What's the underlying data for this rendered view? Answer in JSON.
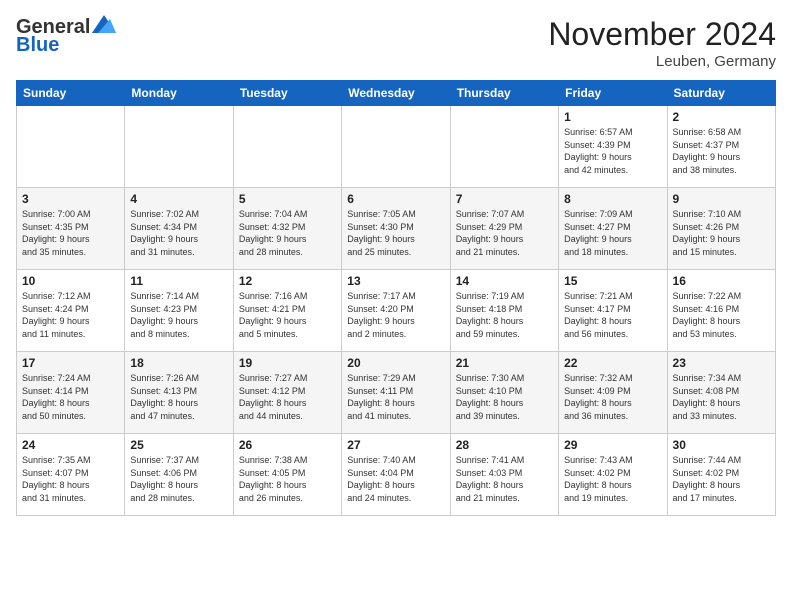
{
  "header": {
    "logo_general": "General",
    "logo_blue": "Blue",
    "month_title": "November 2024",
    "location": "Leuben, Germany"
  },
  "days_of_week": [
    "Sunday",
    "Monday",
    "Tuesday",
    "Wednesday",
    "Thursday",
    "Friday",
    "Saturday"
  ],
  "weeks": [
    [
      {
        "day": "",
        "info": ""
      },
      {
        "day": "",
        "info": ""
      },
      {
        "day": "",
        "info": ""
      },
      {
        "day": "",
        "info": ""
      },
      {
        "day": "",
        "info": ""
      },
      {
        "day": "1",
        "info": "Sunrise: 6:57 AM\nSunset: 4:39 PM\nDaylight: 9 hours\nand 42 minutes."
      },
      {
        "day": "2",
        "info": "Sunrise: 6:58 AM\nSunset: 4:37 PM\nDaylight: 9 hours\nand 38 minutes."
      }
    ],
    [
      {
        "day": "3",
        "info": "Sunrise: 7:00 AM\nSunset: 4:35 PM\nDaylight: 9 hours\nand 35 minutes."
      },
      {
        "day": "4",
        "info": "Sunrise: 7:02 AM\nSunset: 4:34 PM\nDaylight: 9 hours\nand 31 minutes."
      },
      {
        "day": "5",
        "info": "Sunrise: 7:04 AM\nSunset: 4:32 PM\nDaylight: 9 hours\nand 28 minutes."
      },
      {
        "day": "6",
        "info": "Sunrise: 7:05 AM\nSunset: 4:30 PM\nDaylight: 9 hours\nand 25 minutes."
      },
      {
        "day": "7",
        "info": "Sunrise: 7:07 AM\nSunset: 4:29 PM\nDaylight: 9 hours\nand 21 minutes."
      },
      {
        "day": "8",
        "info": "Sunrise: 7:09 AM\nSunset: 4:27 PM\nDaylight: 9 hours\nand 18 minutes."
      },
      {
        "day": "9",
        "info": "Sunrise: 7:10 AM\nSunset: 4:26 PM\nDaylight: 9 hours\nand 15 minutes."
      }
    ],
    [
      {
        "day": "10",
        "info": "Sunrise: 7:12 AM\nSunset: 4:24 PM\nDaylight: 9 hours\nand 11 minutes."
      },
      {
        "day": "11",
        "info": "Sunrise: 7:14 AM\nSunset: 4:23 PM\nDaylight: 9 hours\nand 8 minutes."
      },
      {
        "day": "12",
        "info": "Sunrise: 7:16 AM\nSunset: 4:21 PM\nDaylight: 9 hours\nand 5 minutes."
      },
      {
        "day": "13",
        "info": "Sunrise: 7:17 AM\nSunset: 4:20 PM\nDaylight: 9 hours\nand 2 minutes."
      },
      {
        "day": "14",
        "info": "Sunrise: 7:19 AM\nSunset: 4:18 PM\nDaylight: 8 hours\nand 59 minutes."
      },
      {
        "day": "15",
        "info": "Sunrise: 7:21 AM\nSunset: 4:17 PM\nDaylight: 8 hours\nand 56 minutes."
      },
      {
        "day": "16",
        "info": "Sunrise: 7:22 AM\nSunset: 4:16 PM\nDaylight: 8 hours\nand 53 minutes."
      }
    ],
    [
      {
        "day": "17",
        "info": "Sunrise: 7:24 AM\nSunset: 4:14 PM\nDaylight: 8 hours\nand 50 minutes."
      },
      {
        "day": "18",
        "info": "Sunrise: 7:26 AM\nSunset: 4:13 PM\nDaylight: 8 hours\nand 47 minutes."
      },
      {
        "day": "19",
        "info": "Sunrise: 7:27 AM\nSunset: 4:12 PM\nDaylight: 8 hours\nand 44 minutes."
      },
      {
        "day": "20",
        "info": "Sunrise: 7:29 AM\nSunset: 4:11 PM\nDaylight: 8 hours\nand 41 minutes."
      },
      {
        "day": "21",
        "info": "Sunrise: 7:30 AM\nSunset: 4:10 PM\nDaylight: 8 hours\nand 39 minutes."
      },
      {
        "day": "22",
        "info": "Sunrise: 7:32 AM\nSunset: 4:09 PM\nDaylight: 8 hours\nand 36 minutes."
      },
      {
        "day": "23",
        "info": "Sunrise: 7:34 AM\nSunset: 4:08 PM\nDaylight: 8 hours\nand 33 minutes."
      }
    ],
    [
      {
        "day": "24",
        "info": "Sunrise: 7:35 AM\nSunset: 4:07 PM\nDaylight: 8 hours\nand 31 minutes."
      },
      {
        "day": "25",
        "info": "Sunrise: 7:37 AM\nSunset: 4:06 PM\nDaylight: 8 hours\nand 28 minutes."
      },
      {
        "day": "26",
        "info": "Sunrise: 7:38 AM\nSunset: 4:05 PM\nDaylight: 8 hours\nand 26 minutes."
      },
      {
        "day": "27",
        "info": "Sunrise: 7:40 AM\nSunset: 4:04 PM\nDaylight: 8 hours\nand 24 minutes."
      },
      {
        "day": "28",
        "info": "Sunrise: 7:41 AM\nSunset: 4:03 PM\nDaylight: 8 hours\nand 21 minutes."
      },
      {
        "day": "29",
        "info": "Sunrise: 7:43 AM\nSunset: 4:02 PM\nDaylight: 8 hours\nand 19 minutes."
      },
      {
        "day": "30",
        "info": "Sunrise: 7:44 AM\nSunset: 4:02 PM\nDaylight: 8 hours\nand 17 minutes."
      }
    ]
  ]
}
